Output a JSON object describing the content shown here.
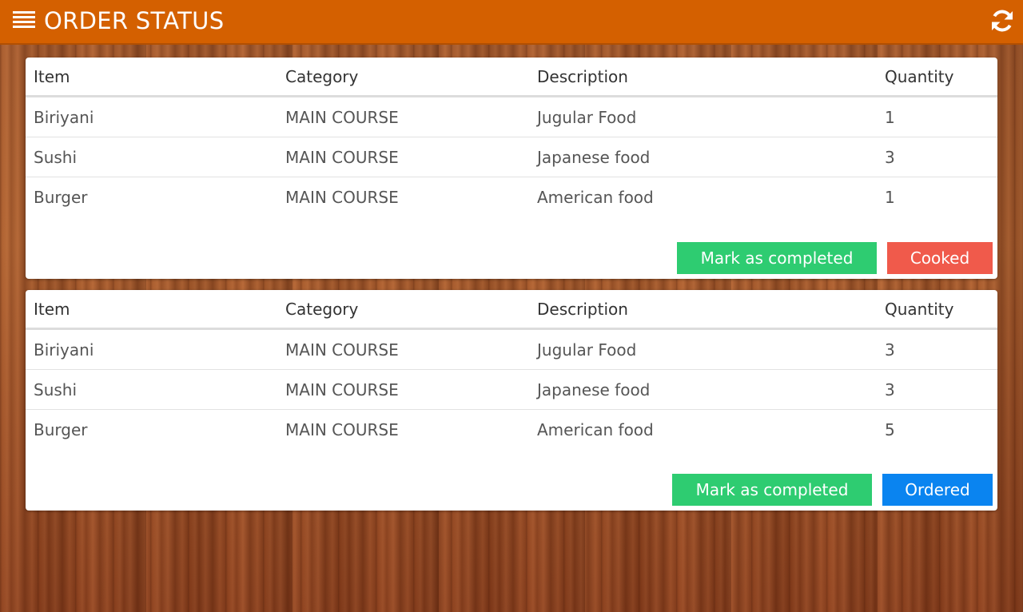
{
  "header": {
    "title": "ORDER STATUS",
    "menu_icon": "hamburger-menu-icon",
    "refresh_icon": "refresh-icon",
    "accent_color": "#d46000"
  },
  "columns": [
    "Item",
    "Category",
    "Description",
    "Quantity"
  ],
  "orders": [
    {
      "rows": [
        {
          "item": "Biriyani",
          "category": "MAIN COURSE",
          "description": "Jugular Food",
          "quantity": "1"
        },
        {
          "item": "Sushi",
          "category": "MAIN COURSE",
          "description": "Japanese food",
          "quantity": "3"
        },
        {
          "item": "Burger",
          "category": "MAIN COURSE",
          "description": "American food",
          "quantity": "1"
        }
      ],
      "complete_label": "Mark as completed",
      "status_label": "Cooked",
      "status_color": "#f05a4b"
    },
    {
      "rows": [
        {
          "item": "Biriyani",
          "category": "MAIN COURSE",
          "description": "Jugular Food",
          "quantity": "3"
        },
        {
          "item": "Sushi",
          "category": "MAIN COURSE",
          "description": "Japanese food",
          "quantity": "3"
        },
        {
          "item": "Burger",
          "category": "MAIN COURSE",
          "description": "American food",
          "quantity": "5"
        }
      ],
      "complete_label": "Mark as completed",
      "status_label": "Ordered",
      "status_color": "#0a84f0"
    }
  ]
}
